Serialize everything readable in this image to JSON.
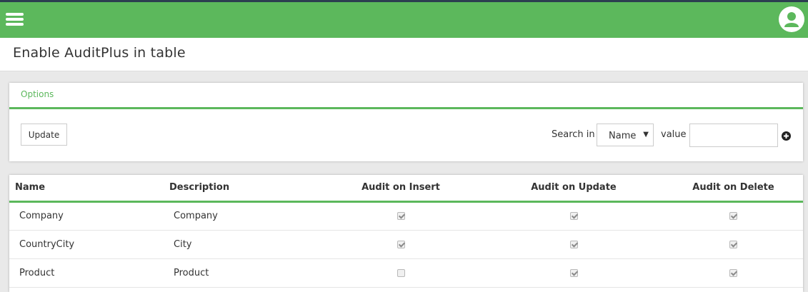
{
  "header": {
    "menu_icon": "hamburger-menu-icon",
    "user_icon": "user-avatar-icon",
    "accent_color": "#5cb85c"
  },
  "page": {
    "title": "Enable AuditPlus in table"
  },
  "options": {
    "title": "Options",
    "update_label": "Update",
    "search_in_label": "Search in",
    "search_field": {
      "selected": "Name"
    },
    "value_label": "value",
    "value_input": "",
    "add_icon": "plus-circle-icon"
  },
  "table": {
    "columns": [
      "Name",
      "Description",
      "Audit on Insert",
      "Audit on Update",
      "Audit on Delete"
    ],
    "rows": [
      {
        "name": "Company",
        "description": "Company",
        "insert": true,
        "update": true,
        "delete": true
      },
      {
        "name": "CountryCity",
        "description": "City",
        "insert": true,
        "update": true,
        "delete": true
      },
      {
        "name": "Product",
        "description": "Product",
        "insert": false,
        "update": true,
        "delete": true
      }
    ]
  }
}
